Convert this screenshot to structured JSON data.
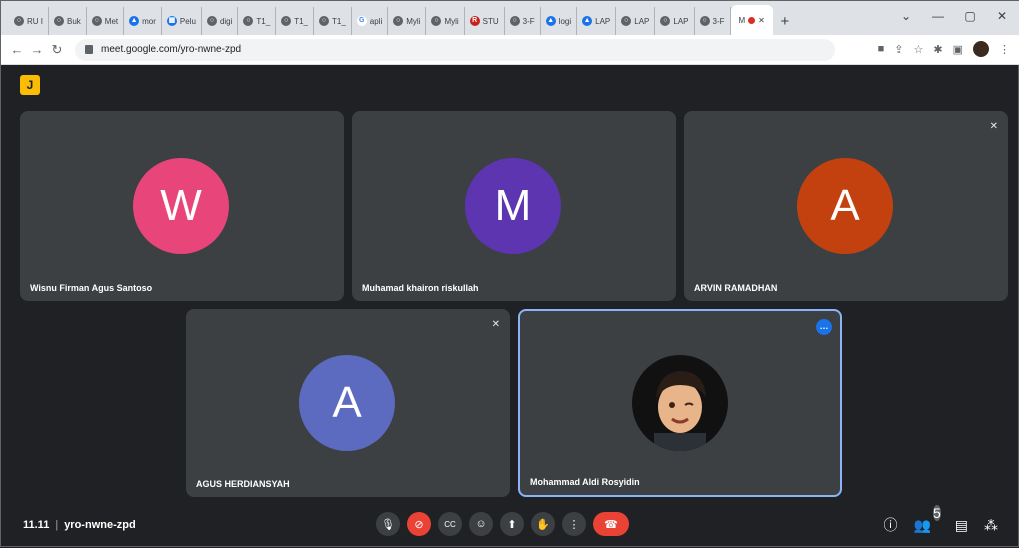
{
  "browser": {
    "tabs": [
      {
        "icon": "globe-icon",
        "label": "RU I"
      },
      {
        "icon": "globe-icon",
        "label": "Buk"
      },
      {
        "icon": "globe-icon",
        "label": "Met"
      },
      {
        "icon": "drive-icon",
        "label": "mor"
      },
      {
        "icon": "doc-icon",
        "label": "Pelu"
      },
      {
        "icon": "globe-icon",
        "label": "digi"
      },
      {
        "icon": "globe-icon",
        "label": "T1_"
      },
      {
        "icon": "globe-icon",
        "label": "T1_"
      },
      {
        "icon": "globe-icon",
        "label": "T1_"
      },
      {
        "icon": "google-icon",
        "label": "apli"
      },
      {
        "icon": "globe-icon",
        "label": "Myli"
      },
      {
        "icon": "globe-icon",
        "label": "Myli"
      },
      {
        "icon": "r-icon",
        "label": "STU"
      },
      {
        "icon": "globe-icon",
        "label": "3-F"
      },
      {
        "icon": "drive-icon",
        "label": "logi"
      },
      {
        "icon": "drive-icon",
        "label": "LAP"
      },
      {
        "icon": "globe-icon",
        "label": "LAP"
      },
      {
        "icon": "globe-icon",
        "label": "LAP"
      },
      {
        "icon": "globe-icon",
        "label": "3-F"
      }
    ],
    "active_tab_label": "M",
    "new_tab": "+",
    "url": "meet.google.com/yro-nwne-zpd",
    "window": {
      "chevron": "⌄",
      "minimize": "—",
      "maximize": "▢",
      "close": "✕"
    }
  },
  "meet": {
    "logo": "J",
    "participants": [
      {
        "name": "Wisnu Firman Agus Santoso",
        "initial": "W",
        "color": "#e8457a",
        "muted": false
      },
      {
        "name": "Muhamad khairon riskullah",
        "initial": "M",
        "color": "#5e35b1",
        "muted": false
      },
      {
        "name": "ARVIN RAMADHAN",
        "initial": "A",
        "color": "#c3410f",
        "muted": true
      },
      {
        "name": "AGUS HERDIANSYAH",
        "initial": "A",
        "color": "#5c6bc0",
        "muted": true
      },
      {
        "name": "Mohammad Aldi Rosyidin",
        "initial": "",
        "color": "#111",
        "muted": false
      }
    ],
    "time": "11.11",
    "meeting_code": "yro-nwne-zpd",
    "people_count": "5"
  }
}
